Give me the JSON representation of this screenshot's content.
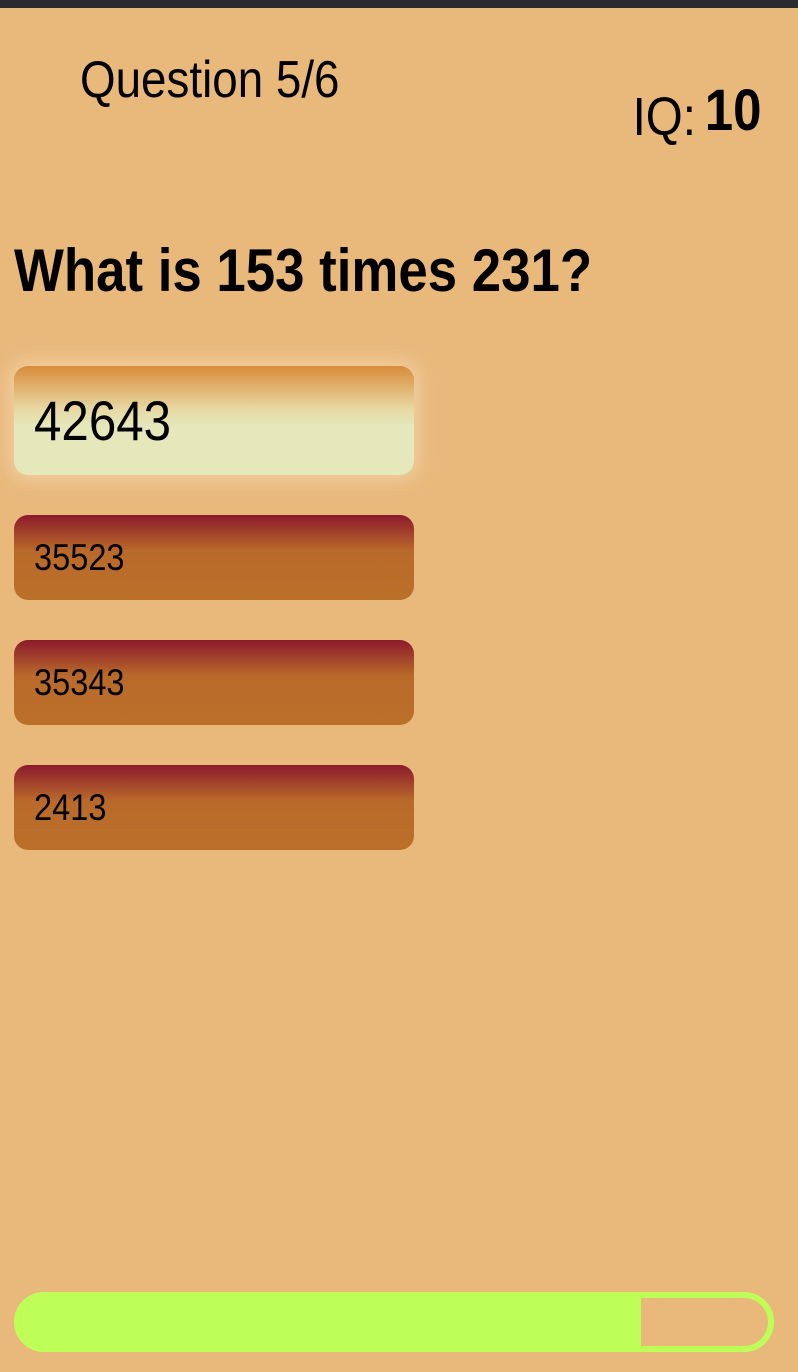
{
  "header": {
    "question_counter": "Question 5/6",
    "iq_label": "IQ:",
    "iq_value": "10"
  },
  "question": {
    "text": "What is 153 times 231?"
  },
  "answers": [
    {
      "label": "42643",
      "selected": true
    },
    {
      "label": "35523",
      "selected": false
    },
    {
      "label": "35343",
      "selected": false
    },
    {
      "label": "2413",
      "selected": false
    }
  ],
  "progress": {
    "fraction": 0.83
  },
  "colors": {
    "background": "#E9B97C",
    "top_bar": "#2B2B2F",
    "progress": "#BEFF57",
    "answer_dark": "#8B1A2C",
    "answer_base": "#BB7029",
    "answer_selected": "#E4E8BB"
  }
}
